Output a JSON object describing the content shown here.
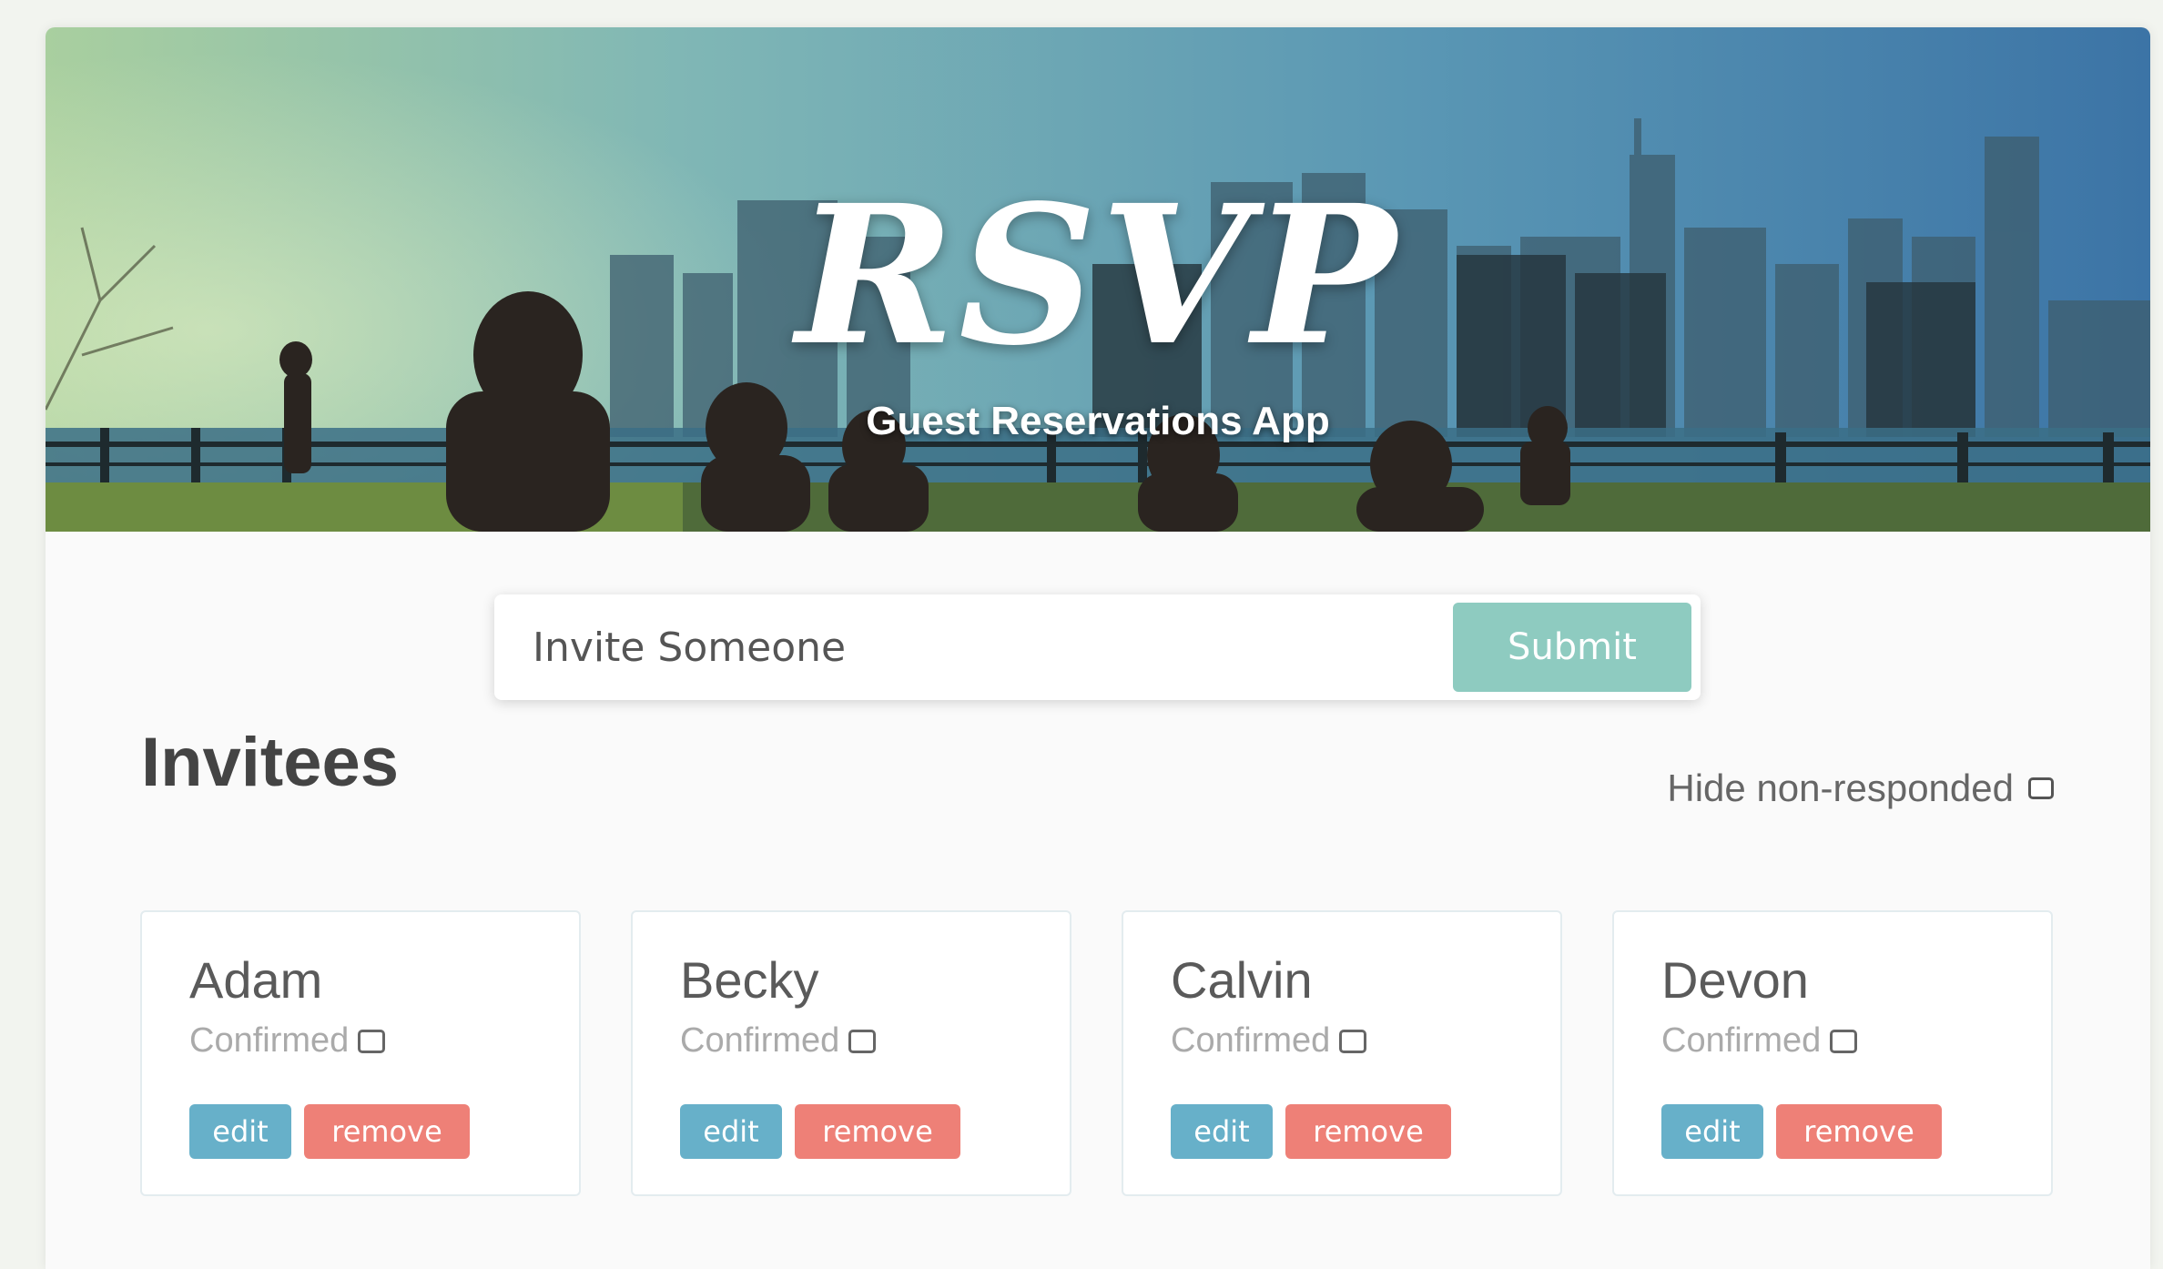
{
  "header": {
    "title": "RSVP",
    "subtitle": "Guest Reservations App"
  },
  "invite": {
    "placeholder": "Invite Someone",
    "submit_label": "Submit"
  },
  "invitees": {
    "heading": "Invitees",
    "filter_label": "Hide non-responded",
    "filter_checked": false
  },
  "guests": [
    {
      "name": "Adam",
      "status_label": "Confirmed",
      "confirmed": false,
      "edit_label": "edit",
      "remove_label": "remove"
    },
    {
      "name": "Becky",
      "status_label": "Confirmed",
      "confirmed": false,
      "edit_label": "edit",
      "remove_label": "remove"
    },
    {
      "name": "Calvin",
      "status_label": "Confirmed",
      "confirmed": false,
      "edit_label": "edit",
      "remove_label": "remove"
    },
    {
      "name": "Devon",
      "status_label": "Confirmed",
      "confirmed": false,
      "edit_label": "edit",
      "remove_label": "remove"
    }
  ],
  "colors": {
    "submit": "#8ecbc0",
    "edit": "#67b0c9",
    "remove": "#ee8077"
  }
}
